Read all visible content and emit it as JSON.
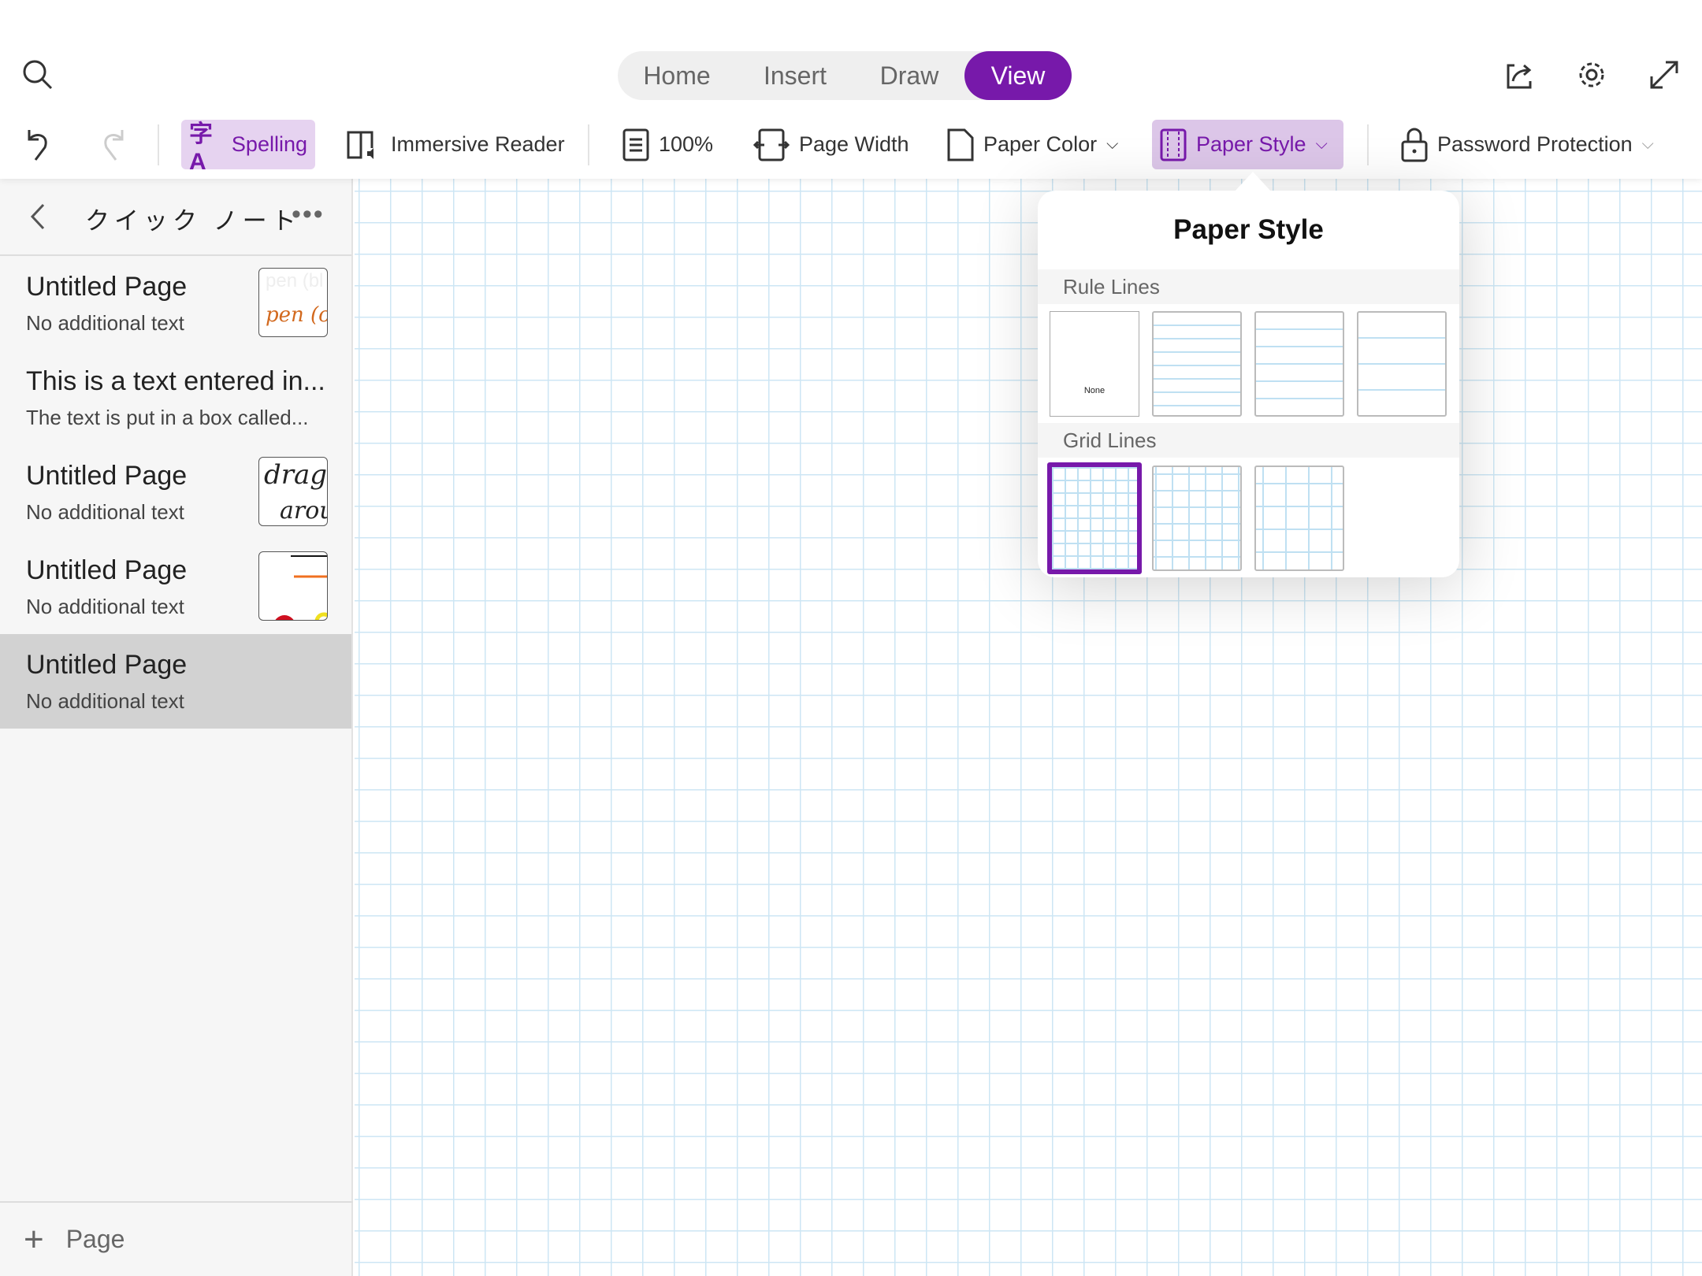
{
  "header": {
    "tabs": [
      {
        "label": "Home"
      },
      {
        "label": "Insert"
      },
      {
        "label": "Draw"
      },
      {
        "label": "View",
        "active": true
      }
    ],
    "icons": [
      "search-icon",
      "share-icon",
      "gear-icon",
      "expand-icon"
    ]
  },
  "toolbar": {
    "spelling": "Spelling",
    "immersive_reader": "Immersive Reader",
    "zoom": "100%",
    "page_width": "Page Width",
    "paper_color": "Paper Color",
    "paper_style": "Paper Style",
    "password_protection": "Password Protection"
  },
  "sidebar": {
    "notebook_title": "クイック ノート",
    "pages": [
      {
        "title": "Untitled Page",
        "subtitle": "No additional text"
      },
      {
        "title": "This is a text entered in...",
        "subtitle": "The text is put in a box called..."
      },
      {
        "title": "Untitled Page",
        "subtitle": "No additional text"
      },
      {
        "title": "Untitled Page",
        "subtitle": "No additional text"
      },
      {
        "title": "Untitled Page",
        "subtitle": "No additional text",
        "selected": true
      }
    ],
    "thumb_text": {
      "t1a": "pen (bl",
      "t1b": "pen (ora",
      "t3a": "drag",
      "t3b": "arou"
    },
    "add_page": "Page"
  },
  "popup": {
    "title": "Paper Style",
    "rule_lines_label": "Rule Lines",
    "none_label": "None",
    "grid_lines_label": "Grid Lines",
    "selected": "grid-small"
  },
  "colors": {
    "accent": "#7719aa",
    "grid": "#cde6f4"
  }
}
